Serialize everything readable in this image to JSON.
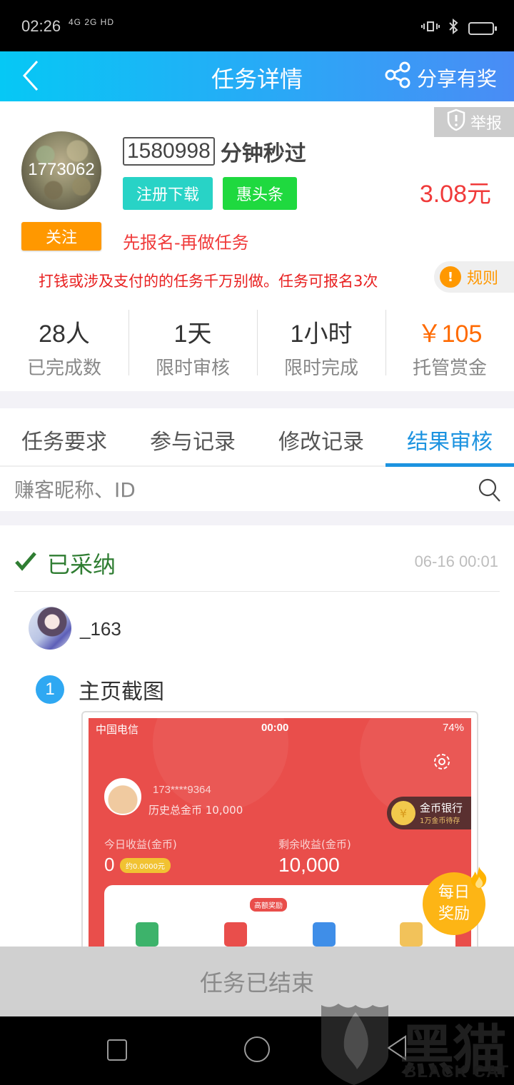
{
  "status_bar": {
    "time": "02:26",
    "network": "4G 2G HD",
    "icons": [
      "vibrate-icon",
      "bluetooth-icon",
      "battery-icon"
    ]
  },
  "header": {
    "back_icon": "chevron-left-icon",
    "title": "任务详情",
    "share_icon": "share-icon",
    "share_label": "分享有奖"
  },
  "task": {
    "report_label": "举报",
    "publisher_id": "1773062",
    "follow_label": "关注",
    "task_id": "1580998",
    "task_name": "分钟秒过",
    "tags": [
      "注册下载",
      "惠头条"
    ],
    "tag_colors": [
      "#28d3c6",
      "#1fd93f"
    ],
    "price": "3.08元",
    "note": "先报名-再做任务",
    "warning": "打钱或涉及支付的的任务千万别做。任务可报名3次",
    "rules_label": "规则"
  },
  "stats": [
    {
      "value": "28人",
      "label": "已完成数"
    },
    {
      "value": "1天",
      "label": "限时审核"
    },
    {
      "value": "1小时",
      "label": "限时完成"
    },
    {
      "value": "￥105",
      "label": "托管赏金"
    }
  ],
  "tabs": [
    {
      "label": "任务要求",
      "active": false
    },
    {
      "label": "参与记录",
      "active": false
    },
    {
      "label": "修改记录",
      "active": false
    },
    {
      "label": "结果审核",
      "active": true
    }
  ],
  "search": {
    "placeholder": "赚客昵称、ID",
    "value": ""
  },
  "result": {
    "status": "已采纳",
    "time": "06-16 00:01",
    "user_name": "_163",
    "step_number": "1",
    "step_label": "主页截图"
  },
  "screenshot": {
    "carrier": "中国电信",
    "time": "00:00",
    "battery": "74%",
    "phone": "173****9364",
    "history_coins": "历史总金币 10,000",
    "bank_title": "金币银行",
    "bank_sub": "1万金币待存",
    "today_label": "今日收益(金币)",
    "today_value": "0",
    "today_approx": "约0.0000元",
    "remain_label": "剩余收益(金币)",
    "remain_value": "10,000",
    "hot_badge": "高额奖励",
    "daily_line1": "每日",
    "daily_line2": "奖励"
  },
  "footer": {
    "ended_label": "任务已结束"
  },
  "watermark": {
    "text": "黑猫",
    "sub": "BLACK CAT"
  },
  "colors": {
    "header_start": "#06c8f5",
    "header_end": "#4a8cf5",
    "accent_blue": "#1c93e0",
    "price_red": "#f03a3a",
    "reward_orange": "#ff6a00",
    "follow_orange": "#ff9800",
    "accepted_green": "#2f7d32"
  }
}
